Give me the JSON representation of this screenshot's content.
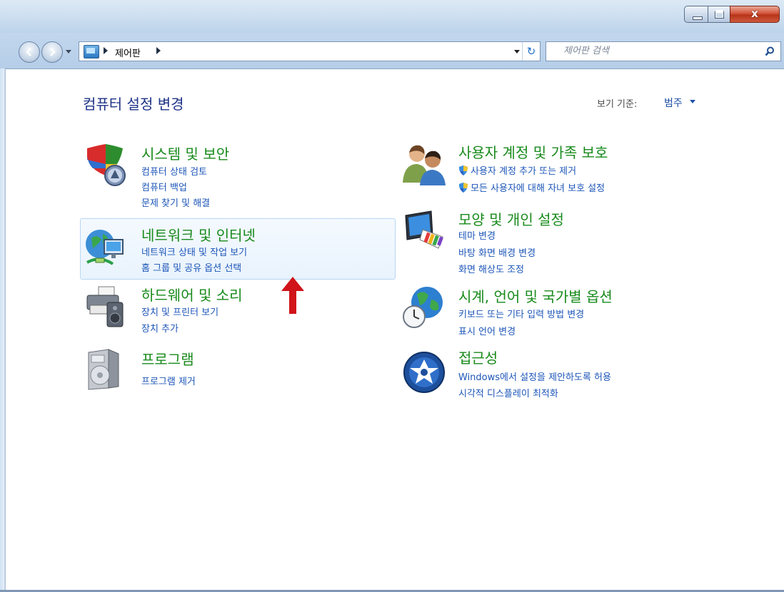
{
  "window": {
    "close_glyph": "x"
  },
  "address_bar": {
    "breadcrumb": "제어판",
    "refresh_glyph": "↻"
  },
  "search": {
    "placeholder": "제어판 검색"
  },
  "header": {
    "title": "컴퓨터 설정 변경",
    "view_by_label": "보기 기준:",
    "view_by_value": "범주"
  },
  "categories": [
    {
      "id": "system-security",
      "title": "시스템 및 보안",
      "icon": "shield-icon",
      "links": [
        "컴퓨터 상태 검토",
        "컴퓨터 백업",
        "문제 찾기 및 해결"
      ]
    },
    {
      "id": "network-internet",
      "title": "네트워크 및 인터넷",
      "icon": "network-globe-icon",
      "links": [
        "네트워크 상태 및 작업 보기",
        "홈 그룹 및 공유 옵션 선택"
      ]
    },
    {
      "id": "hardware-sound",
      "title": "하드웨어 및 소리",
      "icon": "printer-speaker-icon",
      "links": [
        "장치 및 프린터 보기",
        "장치 추가"
      ]
    },
    {
      "id": "programs",
      "title": "프로그램",
      "icon": "programs-box-icon",
      "links": [
        "프로그램 제거"
      ]
    },
    {
      "id": "user-accounts",
      "title": "사용자 계정 및 가족 보호",
      "icon": "users-icon",
      "links": [
        "사용자 계정 추가 또는 제거",
        "모든 사용자에 대해 자녀 보호 설정"
      ]
    },
    {
      "id": "appearance",
      "title": "모양 및 개인 설정",
      "icon": "monitor-palette-icon",
      "links": [
        "테마 변경",
        "바탕 화면 배경 변경",
        "화면 해상도 조정"
      ]
    },
    {
      "id": "clock-language",
      "title": "시계, 언어 및 국가별 옵션",
      "icon": "globe-clock-icon",
      "links": [
        "키보드 또는 기타 입력 방법 변경",
        "표시 언어 변경"
      ]
    },
    {
      "id": "ease-of-access",
      "title": "접근성",
      "icon": "ease-of-access-icon",
      "links": [
        "Windows에서 설정을 제안하도록 허용",
        "시각적 디스플레이 최적화"
      ]
    }
  ],
  "colors": {
    "category_title": "#188a1b",
    "link": "#1d56b8",
    "page_title": "#1e3287",
    "annotation_arrow": "#d0141a"
  }
}
